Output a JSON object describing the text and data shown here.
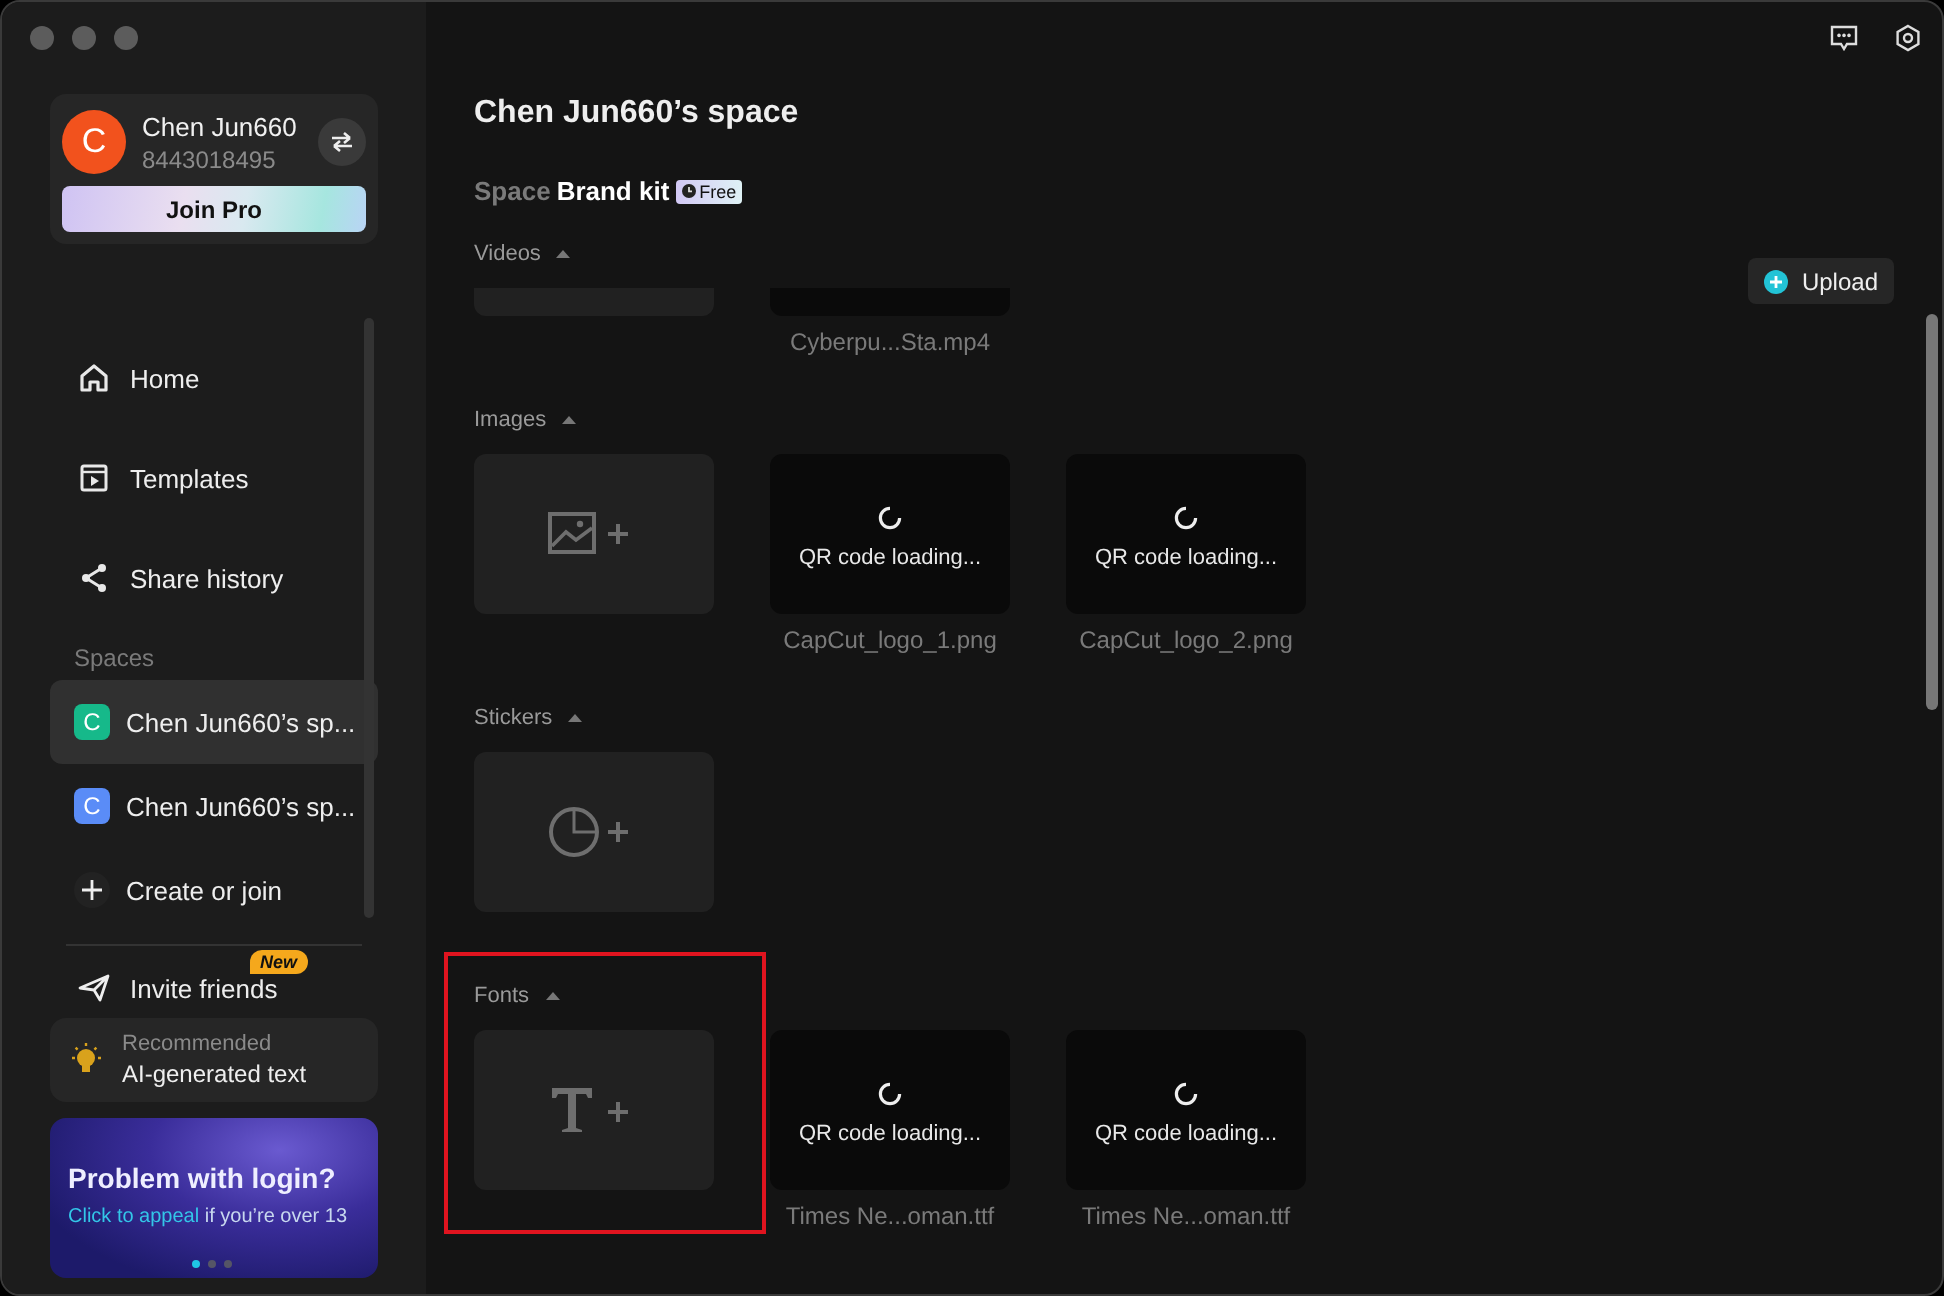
{
  "profile": {
    "avatar_letter": "C",
    "name": "Chen Jun660",
    "id": "8443018495",
    "join_button": "Join Pro"
  },
  "nav": [
    {
      "kind": "home",
      "label": "Home",
      "selected": false
    },
    {
      "kind": "templates",
      "label": "Templates",
      "selected": false
    },
    {
      "kind": "share",
      "label": "Share history",
      "selected": false
    }
  ],
  "spaces_label": "Spaces",
  "spaces": [
    {
      "letter": "C",
      "color": "#16b98a",
      "name": "Chen Jun660’s sp...",
      "selected": true
    },
    {
      "letter": "C",
      "color": "#5a8cf7",
      "name": "Chen Jun660’s sp...",
      "selected": false
    }
  ],
  "create_join": "Create or join",
  "invite": {
    "label": "Invite friends",
    "badge": "New"
  },
  "recommended": {
    "caption": "Recommended",
    "title": "AI-generated text"
  },
  "banner": {
    "title": "Problem with login?",
    "link": "Click to appeal",
    "text": " if you’re over 13",
    "dots": [
      {
        "selected": true
      },
      {
        "selected": false
      },
      {
        "selected": false
      }
    ]
  },
  "main": {
    "title": "Chen Jun660’s space",
    "tabs": [
      {
        "label": "Space",
        "selected": false
      },
      {
        "label": "Brand kit",
        "selected": true,
        "badge": "Free"
      }
    ],
    "upload_button": "Upload",
    "sections": [
      {
        "kind": "videos",
        "title": "Videos",
        "highlighted": false,
        "tiles": [
          {
            "kind": "clipped"
          },
          {
            "kind": "clipped",
            "filename": "Cyberpu...Sta.mp4"
          }
        ]
      },
      {
        "kind": "images",
        "title": "Images",
        "highlighted": false,
        "tiles": [
          {
            "kind": "add"
          },
          {
            "kind": "loading",
            "status": "QR code loading...",
            "filename": "CapCut_logo_1.png"
          },
          {
            "kind": "loading",
            "status": "QR code loading...",
            "filename": "CapCut_logo_2.png"
          }
        ]
      },
      {
        "kind": "stickers",
        "title": "Stickers",
        "highlighted": false,
        "tiles": [
          {
            "kind": "add"
          }
        ]
      },
      {
        "kind": "fonts",
        "title": "Fonts",
        "highlighted": true,
        "tiles": [
          {
            "kind": "add"
          },
          {
            "kind": "loading",
            "status": "QR code loading...",
            "filename": "Times Ne...oman.ttf"
          },
          {
            "kind": "loading",
            "status": "QR code loading...",
            "filename": "Times Ne...oman.ttf"
          }
        ]
      }
    ]
  }
}
